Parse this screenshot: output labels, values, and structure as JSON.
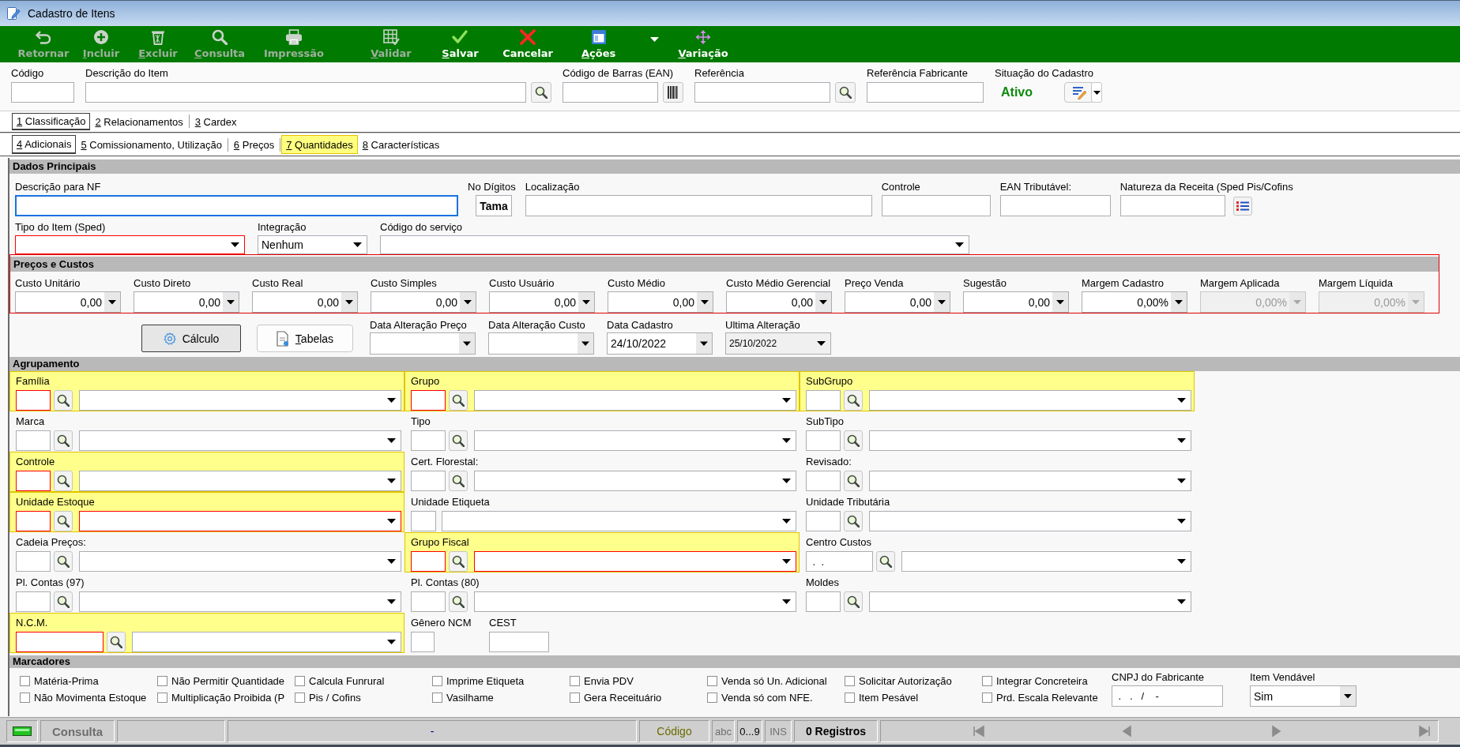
{
  "window": {
    "title": "Cadastro de Itens"
  },
  "toolbar": [
    {
      "label": "Retornar",
      "disabled": true,
      "mnemonic": false,
      "menu": false
    },
    {
      "label": "Incluir",
      "disabled": true,
      "mnemonic": true,
      "menu": false
    },
    {
      "label": "Excluir",
      "disabled": true,
      "mnemonic": true,
      "menu": false
    },
    {
      "label": "Consulta",
      "disabled": true,
      "mnemonic": true,
      "menu": false
    },
    {
      "label": "Impressão",
      "disabled": true,
      "mnemonic": false,
      "menu": false
    },
    {
      "label": "Validar",
      "disabled": true,
      "mnemonic": true,
      "menu": false
    },
    {
      "label": "Salvar",
      "disabled": false,
      "mnemonic": true,
      "menu": false
    },
    {
      "label": "Cancelar",
      "disabled": false,
      "mnemonic": false,
      "menu": false
    },
    {
      "label": "Ações",
      "disabled": false,
      "mnemonic": true,
      "menu": true
    },
    {
      "label": "Variação",
      "disabled": false,
      "mnemonic": true,
      "menu": false
    }
  ],
  "header": {
    "fields": [
      {
        "label": "Código",
        "kind": "text"
      },
      {
        "label": "Descrição do Item",
        "kind": "search"
      },
      {
        "label": "Código de Barras (EAN)",
        "kind": "barcode"
      },
      {
        "label": "Referência",
        "kind": "search"
      },
      {
        "label": "Referência Fabricante",
        "kind": "text"
      }
    ],
    "situacao": {
      "label": "Situação do Cadastro",
      "value": "Ativo"
    }
  },
  "tabs": [
    {
      "label": "1 Classificação",
      "selected": true
    },
    {
      "label": "2 Relacionamentos",
      "selected": false
    },
    {
      "label": "3 Cardex",
      "selected": false
    }
  ],
  "subtabs": [
    {
      "label": "4 Adicionais",
      "selected": true,
      "highlighted": false
    },
    {
      "label": "5 Comissionamento, Utilização",
      "selected": false,
      "highlighted": false
    },
    {
      "label": "6 Preços",
      "selected": false,
      "highlighted": false
    },
    {
      "label": "7 Quantidades",
      "selected": false,
      "highlighted": true
    },
    {
      "label": "8 Características",
      "selected": false,
      "highlighted": false
    }
  ],
  "dados_principais": {
    "title": "Dados Principais",
    "rows": [
      [
        {
          "label": "Descrição para NF",
          "kind": "text",
          "focused": true,
          "required": false
        },
        {
          "label": "No Dígitos",
          "kind": "static",
          "value": "Tama",
          "focused": false,
          "required": false
        },
        {
          "label": "Localização",
          "kind": "text",
          "focused": false,
          "required": false
        },
        {
          "label": "Controle",
          "kind": "text",
          "focused": false,
          "required": false
        },
        {
          "label": "EAN Tributável:",
          "kind": "text",
          "focused": false,
          "required": false
        },
        {
          "label": "Natureza da Receita (Sped Pis/Cofins",
          "kind": "list",
          "focused": false,
          "required": false
        }
      ],
      [
        {
          "label": "Tipo do Item (Sped)",
          "kind": "select",
          "focused": false,
          "required": true
        },
        {
          "label": "Integração",
          "kind": "select",
          "value": "Nenhum",
          "focused": false,
          "required": false
        },
        {
          "label": "Código do serviço",
          "kind": "select",
          "focused": false,
          "required": false
        }
      ]
    ]
  },
  "precos": {
    "title": "Preços e Custos",
    "outlined": true,
    "fields": [
      {
        "label": "Custo Unitário",
        "value": "0,00",
        "disabled": false
      },
      {
        "label": "Custo Direto",
        "value": "0,00",
        "disabled": false
      },
      {
        "label": "Custo Real",
        "value": "0,00",
        "disabled": false
      },
      {
        "label": "Custo Simples",
        "value": "0,00",
        "disabled": false
      },
      {
        "label": "Custo Usuário",
        "value": "0,00",
        "disabled": false
      },
      {
        "label": "Custo Médio",
        "value": "0,00",
        "disabled": false
      },
      {
        "label": "Custo Médio Gerencial",
        "value": "0,00",
        "disabled": false
      },
      {
        "label": "Preço Venda",
        "value": "0,00",
        "disabled": false
      },
      {
        "label": "Sugestão",
        "value": "0,00",
        "disabled": false
      },
      {
        "label": "Margem Cadastro",
        "value": "0,00%",
        "disabled": false
      },
      {
        "label": "Margem Aplicada",
        "value": "0,00%",
        "disabled": true
      },
      {
        "label": "Margem Líquida",
        "value": "0,00%",
        "disabled": true
      }
    ]
  },
  "actions": {
    "buttons": [
      {
        "label": "Cálculo",
        "focused": true,
        "mnemonic": false
      },
      {
        "label": "Tabelas",
        "focused": false,
        "mnemonic": true
      }
    ],
    "dates": [
      {
        "label": "Data Alteração Preço",
        "readonly": false
      },
      {
        "label": "Data Alteração Custo",
        "readonly": false
      },
      {
        "label": "Data Cadastro",
        "value": "24/10/2022",
        "readonly": false
      },
      {
        "label": "Ultima Alteração",
        "value": "25/10/2022",
        "readonly": true
      }
    ]
  },
  "agrupamento": {
    "title": "Agrupamento",
    "rows": [
      [
        {
          "label": "Família",
          "kind": "lookup",
          "highlighted": true,
          "required": true,
          "select_required": false
        },
        {
          "label": "Grupo",
          "kind": "lookup",
          "highlighted": true,
          "required": true,
          "select_required": false
        },
        {
          "label": "SubGrupo",
          "kind": "lookup",
          "highlighted": true,
          "required": false,
          "select_required": false
        }
      ],
      [
        {
          "label": "Marca",
          "kind": "lookup",
          "highlighted": false,
          "required": false,
          "select_required": false
        },
        {
          "label": "Tipo",
          "kind": "lookup",
          "highlighted": false,
          "required": false,
          "select_required": false
        },
        {
          "label": "SubTipo",
          "kind": "lookup",
          "highlighted": false,
          "required": false,
          "select_required": false
        }
      ],
      [
        {
          "label": "Controle",
          "kind": "lookup",
          "highlighted": true,
          "required": true,
          "select_required": false
        },
        {
          "label": "Cert. Florestal:",
          "kind": "lookup",
          "highlighted": false,
          "required": false,
          "select_required": false
        },
        {
          "label": "Revisado:",
          "kind": "lookup",
          "highlighted": false,
          "required": false,
          "select_required": false
        }
      ],
      [
        {
          "label": "Unidade Estoque",
          "kind": "lookup",
          "highlighted": true,
          "required": true,
          "select_required": true
        },
        {
          "label": "Unidade Etiqueta",
          "kind": "combo",
          "highlighted": false,
          "required": false,
          "select_required": false
        },
        {
          "label": "Unidade Tributária",
          "kind": "lookup",
          "highlighted": false,
          "required": false,
          "select_required": false
        }
      ],
      [
        {
          "label": "Cadeia Preços:",
          "kind": "lookup",
          "highlighted": false,
          "required": false,
          "select_required": false
        },
        {
          "label": "Grupo Fiscal",
          "kind": "lookup",
          "highlighted": true,
          "required": true,
          "select_required": true
        },
        {
          "label": "Centro Custos",
          "kind": "lookup_masked",
          "code": " .  .",
          "highlighted": false,
          "required": false,
          "select_required": false
        }
      ],
      [
        {
          "label": "Pl. Contas (97)",
          "kind": "lookup",
          "highlighted": false,
          "required": false,
          "select_required": false
        },
        {
          "label": "Pl. Contas (80)",
          "kind": "lookup",
          "highlighted": false,
          "required": false,
          "select_required": false
        },
        {
          "label": "Moldes",
          "kind": "lookup",
          "highlighted": false,
          "required": false,
          "select_required": false
        }
      ],
      [
        {
          "label": "N.C.M.",
          "kind": "lookup_wide",
          "highlighted": true,
          "required": true,
          "select_required": false
        },
        {
          "label": "Gênero NCM",
          "kind": "text_short",
          "highlighted": false,
          "required": false
        },
        {
          "label": "CEST",
          "kind": "text",
          "highlighted": false,
          "required": false
        }
      ]
    ]
  },
  "marcadores": {
    "title": "Marcadores",
    "checkboxes": [
      {
        "label": "Matéria-Prima",
        "checked": false
      },
      {
        "label": "Não Movimenta Estoque",
        "checked": false
      },
      {
        "label": "Não Permitir Quantidade",
        "checked": false
      },
      {
        "label": "Multiplicação Proibida (P",
        "checked": false
      },
      {
        "label": "Calcula Funrural",
        "checked": false
      },
      {
        "label": "Pis / Cofins",
        "checked": false
      },
      {
        "label": "Imprime Etiqueta",
        "checked": false
      },
      {
        "label": "Vasilhame",
        "checked": false
      },
      {
        "label": "Envia PDV",
        "checked": false
      },
      {
        "label": "Gera Receituário",
        "checked": false
      },
      {
        "label": "Venda só Un. Adicional",
        "checked": false
      },
      {
        "label": "Venda só com NFE.",
        "checked": false
      },
      {
        "label": "Solicitar Autorização",
        "checked": false
      },
      {
        "label": "Item Pesável",
        "checked": false
      },
      {
        "label": "Integrar Concreteira",
        "checked": false
      },
      {
        "label": "Prd. Escala Relevante",
        "checked": false
      }
    ],
    "cnpj": {
      "label": "CNPJ do Fabricante",
      "value": " .   .   /    -"
    },
    "item_vendavel": {
      "label": "Item Vendável",
      "value": "Sim"
    }
  },
  "status_bar": {
    "mode": "Consulta",
    "message": "-",
    "search_field": "Código",
    "keys": [
      {
        "label": "abc",
        "on": false
      },
      {
        "label": "0...9",
        "on": true
      },
      {
        "label": "INS",
        "on": false
      }
    ],
    "records": "0 Registros",
    "navigation": {
      "disabled": true
    }
  }
}
